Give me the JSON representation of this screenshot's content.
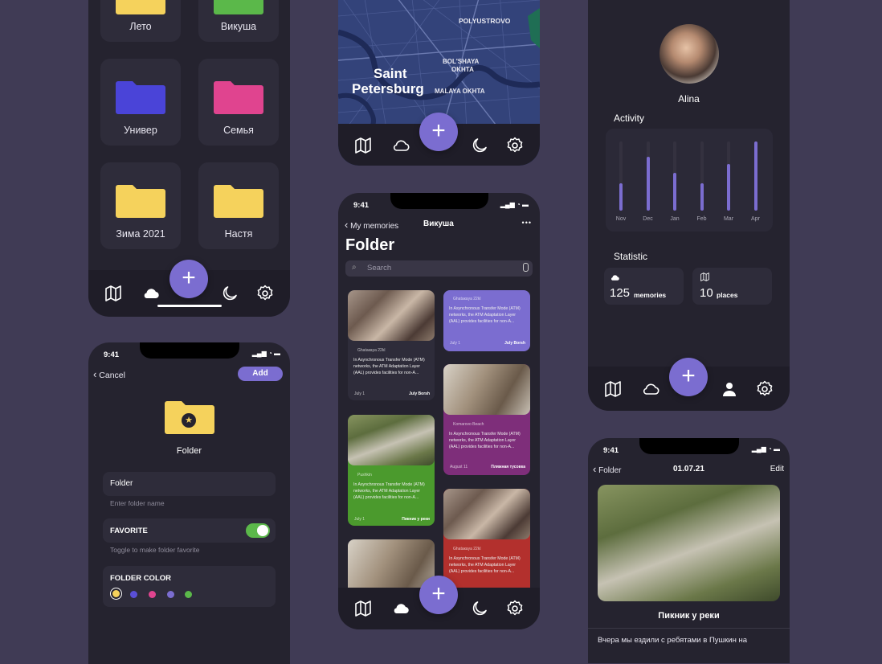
{
  "folders": {
    "tiles": [
      {
        "label": "Лето"
      },
      {
        "label": "Викуша"
      },
      {
        "label": "Универ"
      },
      {
        "label": "Семья"
      },
      {
        "label": "Зима 2021"
      },
      {
        "label": "Настя"
      }
    ]
  },
  "fab": {
    "label": "+"
  },
  "map": {
    "city_line1": "Saint",
    "city_line2": "Petersburg",
    "district1": "POLYUSTROVO",
    "district2_line1": "BOL'SHAYA",
    "district2_line2": "OKHTA",
    "district3": "MALAYA OKHTA"
  },
  "memories": {
    "time": "9:41",
    "back_label": "My memories",
    "nav_title": "Викуша",
    "more_label": "•••",
    "title": "Folder",
    "search_placeholder": "Search",
    "cards": [
      {
        "location": "Ghataкaya 22kl",
        "text": "In Asynchronous Transfer Mode (ATM) networks, the ATM Adaptation Layer (AAL) provides facilities for non-A...",
        "date": "July 1",
        "name": "July Borsh"
      },
      {
        "location": "Ghataкaya 22kl",
        "text": "In Asynchronous Transfer Mode (ATM) networks, the ATM Adaptation Layer (AAL) provides facilities for non-A...",
        "date": "July 1",
        "name": "July Borsh"
      },
      {
        "location": "Komarovo Beach",
        "text": "In Asynchronous Transfer Mode (ATM) networks, the ATM Adaptation Layer (AAL) provides facilities for non-A...",
        "date": "August 11",
        "name": "Пляжная тусовка"
      },
      {
        "location": "Pushkin",
        "text": "In Asynchronous Transfer Mode (ATM) networks, the ATM Adaptation Layer (AAL) provides facilities for non-A...",
        "date": "July 1",
        "name": "Пикник у реки"
      },
      {
        "location": "Ghataкaya 22kl",
        "text": "In Asynchronous Transfer Mode (ATM) networks, the ATM Adaptation Layer (AAL) provides facilities for non-A...",
        "date": "",
        "name": ""
      }
    ]
  },
  "add_folder": {
    "time": "9:41",
    "cancel_label": "Cancel",
    "add_label": "Add",
    "preview_label": "Folder",
    "name_value": "Folder",
    "name_hint": "Enter folder name",
    "favorite_label": "FAVORITE",
    "favorite_on": true,
    "favorite_hint": "Toggle to make folder favorite",
    "color_label": "FOLDER COLOR",
    "colors": [
      "#f5d25c",
      "#5a4fd6",
      "#e0448f",
      "#7b6dd0",
      "#5bb84a"
    ]
  },
  "profile": {
    "name": "Alina",
    "activity_label": "Activity",
    "activity": {
      "type": "bar",
      "categories": [
        "Nov",
        "Dec",
        "Jan",
        "Feb",
        "Mar",
        "Apr"
      ],
      "values": [
        0.4,
        0.78,
        0.55,
        0.4,
        0.67,
        1.0
      ]
    },
    "statistic_label": "Statistic",
    "memories_count": "125",
    "memories_label": "memories",
    "places_count": "10",
    "places_label": "places"
  },
  "detail": {
    "time": "9:41",
    "back_label": "Folder",
    "date": "01.07.21",
    "edit_label": "Edit",
    "title": "Пикник у реки",
    "text": "Вчера мы ездили с ребятами в Пушкин на"
  },
  "colors": {
    "accent": "#7b6dd0",
    "background": "#403b55",
    "panel": "#25232f",
    "folder_yellow": "#f5d25c",
    "folder_blue": "#4a44d8",
    "folder_pink": "#e0448f",
    "folder_green": "#5bb84a"
  }
}
